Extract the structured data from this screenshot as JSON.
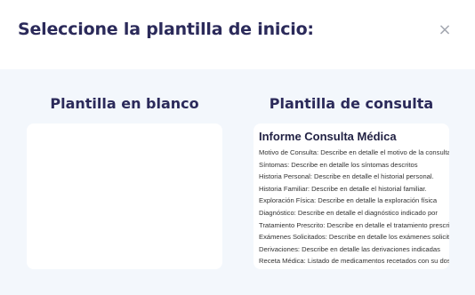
{
  "modal": {
    "title": "Seleccione la plantilla de inicio:",
    "close_label": "×"
  },
  "options": {
    "blank": {
      "title": "Plantilla en blanco"
    },
    "consult": {
      "title": "Plantilla de consulta",
      "preview_title": "Informe Consulta Médica",
      "lines": [
        "Motivo de Consulta: Describe en detalle el motivo de la consulta",
        "Síntomas: Describe en detalle los síntomas descritos",
        "Historia Personal: Describe en detalle el historial personal.",
        "Historia Familiar: Describe en detalle el historial familiar.",
        "Exploración Física: Describe en detalle la exploración física",
        "Diagnóstico: Describe en detalle el diagnóstico indicado por",
        "Tratamiento Prescrito: Describe en detalle el tratamiento prescrito",
        "Exámenes Solicitados: Describe en detalle los exámenes solicitados",
        "Derivaciones: Describe en detalle las derivaciones indicadas",
        "Receta Médica: Listado de medicamentos recetados con su dosis"
      ]
    }
  },
  "colors": {
    "title": "#2b2a5a",
    "body_bg": "#f3f7fc",
    "card_bg": "#ffffff",
    "close_icon": "#a3a7b0"
  }
}
